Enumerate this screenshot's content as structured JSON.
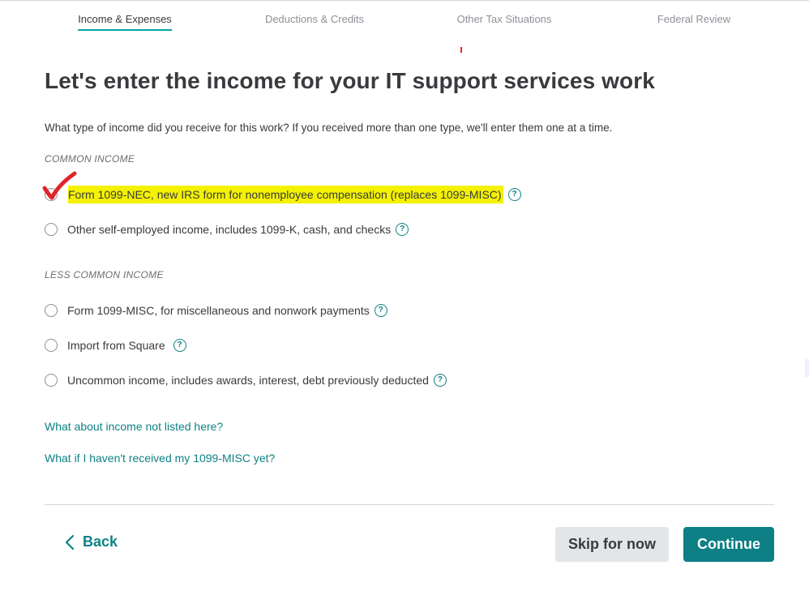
{
  "tabs": [
    {
      "label": "Income & Expenses",
      "active": true
    },
    {
      "label": "Deductions & Credits",
      "active": false
    },
    {
      "label": "Other Tax Situations",
      "active": false
    },
    {
      "label": "Federal Review",
      "active": false
    }
  ],
  "page": {
    "title": "Let's enter the income for your IT support services work",
    "intro": "What type of income did you receive for this work? If you received more than one type, we'll enter them one at a time."
  },
  "sections": {
    "common_label": "COMMON INCOME",
    "less_common_label": "LESS COMMON INCOME"
  },
  "options": {
    "nec": {
      "main": "Form 1099-NEC",
      "sub": ", new IRS form for nonemployee compensation (replaces 1099-MISC)",
      "highlighted": true,
      "annotated_check": true
    },
    "self_employed": {
      "main": "Other self-employed income",
      "sub": ", includes 1099-K, cash, and checks"
    },
    "misc": {
      "main": "Form 1099-MISC",
      "sub": ", for miscellaneous and nonwork payments"
    },
    "square": {
      "main": "Import from Square",
      "sub": ""
    },
    "uncommon": {
      "main": "Uncommon income",
      "sub": ", includes awards, interest, debt previously deducted"
    }
  },
  "help_icon": "question-circle-icon",
  "links": {
    "not_listed": "What about income not listed here?",
    "not_received": "What if I haven't received my 1099-MISC yet?"
  },
  "footer": {
    "back_label": "Back",
    "skip_label": "Skip for now",
    "continue_label": "Continue"
  },
  "colors": {
    "accent_teal": "#0d8285",
    "continue_bg": "#0d7f85",
    "highlight_yellow": "#f4f200",
    "annotation_red": "#e0242b"
  }
}
